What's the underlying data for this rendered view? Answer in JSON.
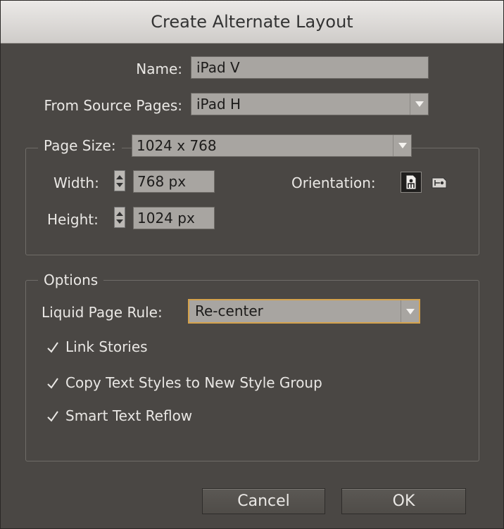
{
  "dialog": {
    "title": "Create Alternate Layout",
    "name_label": "Name:",
    "name_value": "iPad V",
    "source_label": "From Source Pages:",
    "source_value": "iPad H"
  },
  "page_size": {
    "label": "Page Size:",
    "value": "1024 x 768",
    "width_label": "Width:",
    "width_value": "768 px",
    "height_label": "Height:",
    "height_value": "1024 px",
    "orientation_label": "Orientation:",
    "orientation_selected": "portrait"
  },
  "options": {
    "legend": "Options",
    "liquid_label": "Liquid Page Rule:",
    "liquid_value": "Re-center",
    "checkboxes": [
      {
        "label": "Link Stories",
        "checked": true
      },
      {
        "label": "Copy Text Styles to New Style Group",
        "checked": true
      },
      {
        "label": "Smart Text Reflow",
        "checked": true
      }
    ]
  },
  "buttons": {
    "cancel": "Cancel",
    "ok": "OK"
  },
  "colors": {
    "dialog_bg": "#4a4744",
    "field_bg": "#a8a5a1",
    "focus_accent": "#d4a24c"
  }
}
